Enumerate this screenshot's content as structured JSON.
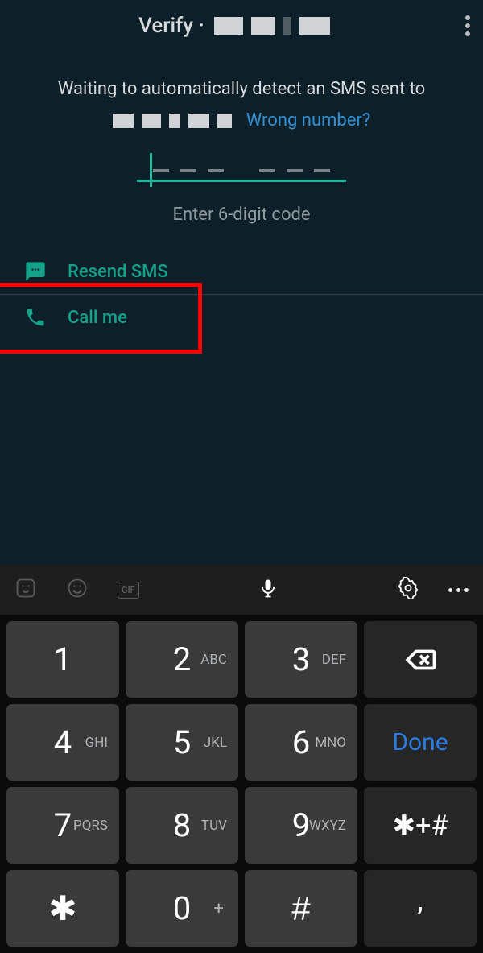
{
  "header": {
    "title": "Verify ·"
  },
  "body": {
    "waiting": "Waiting to automatically detect an SMS sent to",
    "wrong": "Wrong number?",
    "helper": "Enter 6-digit code"
  },
  "options": {
    "resend": "Resend SMS",
    "callme": "Call me"
  },
  "keypad": {
    "k1": {
      "d": "1",
      "l": ""
    },
    "k2": {
      "d": "2",
      "l": "ABC"
    },
    "k3": {
      "d": "3",
      "l": "DEF"
    },
    "k4": {
      "d": "4",
      "l": "GHI"
    },
    "k5": {
      "d": "5",
      "l": "JKL"
    },
    "k6": {
      "d": "6",
      "l": "MNO"
    },
    "k7": {
      "d": "7",
      "l": "PQRS"
    },
    "k8": {
      "d": "8",
      "l": "TUV"
    },
    "k9": {
      "d": "9",
      "l": "WXYZ"
    },
    "k0": {
      "d": "0"
    },
    "star": "✱",
    "hash": "#",
    "symbols": "✱+#",
    "comma": ",",
    "done": "Done",
    "plus": "+"
  },
  "toolbar": {
    "gif": "GIF"
  }
}
